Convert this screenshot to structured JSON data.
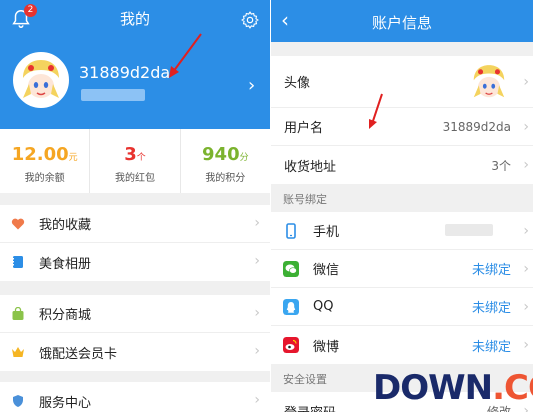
{
  "left": {
    "title": "我的",
    "notification_count": "2",
    "username": "31889d2da",
    "stats": [
      {
        "value": "12.00",
        "unit": "元",
        "label": "我的余额",
        "color": "#f5a623"
      },
      {
        "value": "3",
        "unit": "个",
        "label": "我的红包",
        "color": "#e8332f"
      },
      {
        "value": "940",
        "unit": "分",
        "label": "我的积分",
        "color": "#7bb32e"
      }
    ],
    "menu_group1": [
      {
        "label": "我的收藏",
        "icon": "heart-icon"
      },
      {
        "label": "美食相册",
        "icon": "album-icon"
      }
    ],
    "menu_group2": [
      {
        "label": "积分商城",
        "icon": "shop-bag-icon"
      },
      {
        "label": "饿配送会员卡",
        "icon": "crown-icon"
      }
    ],
    "menu_group3": [
      {
        "label": "服务中心",
        "icon": "service-icon"
      }
    ]
  },
  "right": {
    "title": "账户信息",
    "profile": [
      {
        "label": "头像",
        "value": ""
      },
      {
        "label": "用户名",
        "value": "31889d2da"
      },
      {
        "label": "收货地址",
        "value": "3个"
      }
    ],
    "binding_section": "账号绑定",
    "bindings": [
      {
        "label": "手机",
        "value": "",
        "icon": "phone-icon"
      },
      {
        "label": "微信",
        "value": "未绑定",
        "icon": "wechat-icon"
      },
      {
        "label": "QQ",
        "value": "未绑定",
        "icon": "qq-icon"
      },
      {
        "label": "微博",
        "value": "未绑定",
        "icon": "weibo-icon"
      }
    ],
    "security_section": "安全设置",
    "security": [
      {
        "label": "登录密码",
        "value": "修改"
      }
    ]
  },
  "watermark": {
    "text": "DOWN",
    "suffix": ".CC"
  },
  "colors": {
    "primary": "#2c8ee6",
    "balance": "#f5a623",
    "redpacket": "#e8332f",
    "points": "#7bb32e"
  }
}
